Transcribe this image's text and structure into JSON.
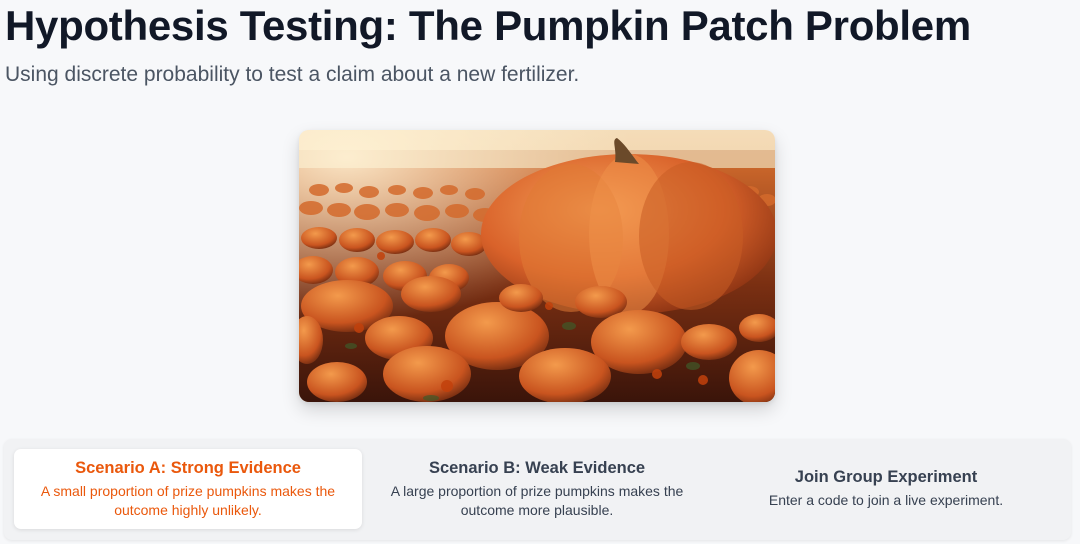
{
  "header": {
    "title": "Hypothesis Testing: The Pumpkin Patch Problem",
    "subtitle": "Using discrete probability to test a claim about a new fertilizer."
  },
  "hero_image": {
    "subject": "pumpkin-patch-illustration"
  },
  "tabs": [
    {
      "title": "Scenario A: Strong Evidence",
      "description": "A small proportion of prize pumpkins makes the outcome highly unlikely.",
      "active": true
    },
    {
      "title": "Scenario B: Weak Evidence",
      "description": "A large proportion of prize pumpkins makes the outcome more plausible.",
      "active": false
    },
    {
      "title": "Join Group Experiment",
      "description": "Enter a code to join a live experiment.",
      "active": false
    }
  ],
  "colors": {
    "accent": "#ea580c",
    "title": "#111827",
    "muted": "#4b5563",
    "background": "#f7f8fa"
  }
}
